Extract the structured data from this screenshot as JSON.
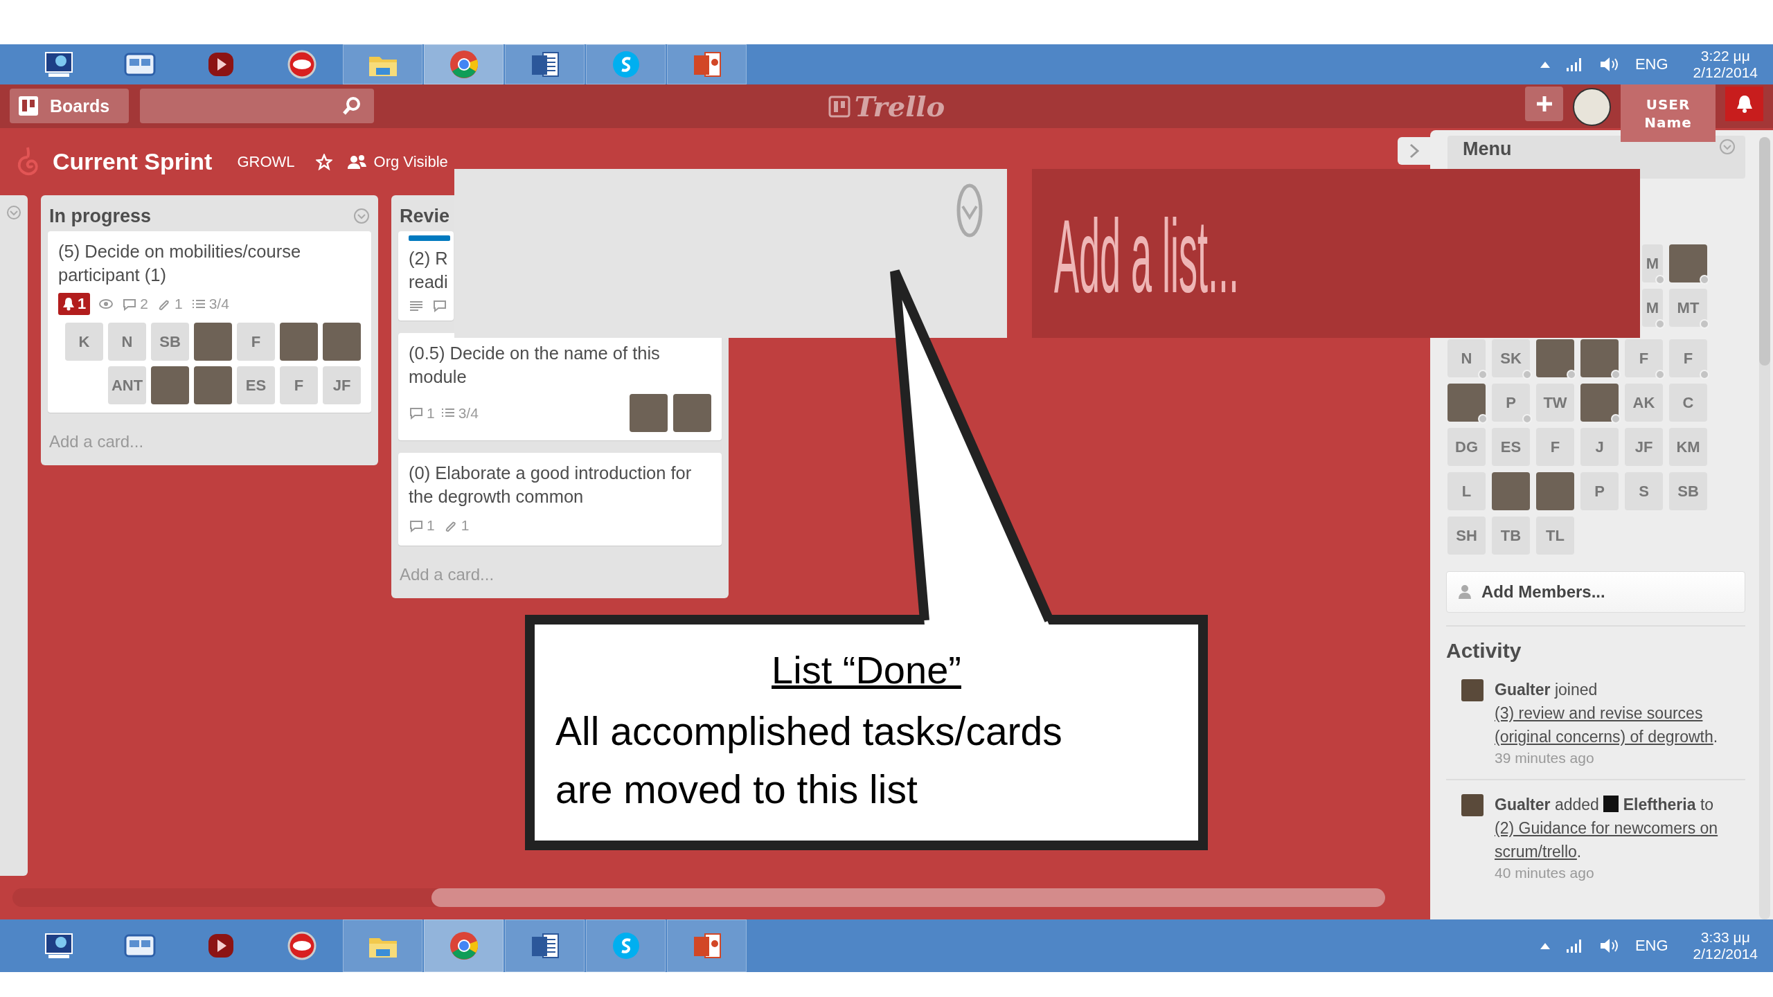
{
  "taskbars": [
    {
      "apps": [
        {
          "kind": "monitor",
          "running": false,
          "selected": false
        },
        {
          "kind": "chat",
          "running": false,
          "selected": false
        },
        {
          "kind": "media",
          "running": false,
          "selected": false
        },
        {
          "kind": "disc",
          "running": false,
          "selected": false
        },
        {
          "kind": "folder",
          "running": true,
          "selected": false
        },
        {
          "kind": "browser",
          "running": true,
          "selected": true
        },
        {
          "kind": "word",
          "running": true,
          "selected": false
        },
        {
          "kind": "skype",
          "running": true,
          "selected": false
        },
        {
          "kind": "slides",
          "running": true,
          "selected": false
        }
      ],
      "language": "ENG",
      "time": "3:22 μμ",
      "date": "2/12/2014"
    },
    {
      "apps": [
        {
          "kind": "monitor",
          "running": false,
          "selected": false
        },
        {
          "kind": "chat",
          "running": false,
          "selected": false
        },
        {
          "kind": "media",
          "running": false,
          "selected": false
        },
        {
          "kind": "disc",
          "running": false,
          "selected": false
        },
        {
          "kind": "folder",
          "running": true,
          "selected": false
        },
        {
          "kind": "browser",
          "running": true,
          "selected": true
        },
        {
          "kind": "word",
          "running": true,
          "selected": false
        },
        {
          "kind": "skype",
          "running": true,
          "selected": false
        },
        {
          "kind": "slides",
          "running": true,
          "selected": false
        }
      ],
      "language": "ENG",
      "time": "3:33 μμ",
      "date": "2/12/2014"
    }
  ],
  "header": {
    "boards_button": "Boards",
    "logo": "Trello",
    "user_name": "USER Name"
  },
  "board": {
    "title": "Current Sprint",
    "organization": "GROWL",
    "visibility": "Org Visible"
  },
  "lists": [
    {
      "title": "In progress",
      "cards": [
        {
          "title": "(5) Decide on mobilities/course participant (1)",
          "badges": [
            {
              "kind": "alert",
              "text": "1"
            },
            {
              "kind": "watch"
            },
            {
              "kind": "comments",
              "text": "2"
            },
            {
              "kind": "attachments",
              "text": "1"
            },
            {
              "kind": "checklist",
              "text": "3/4"
            }
          ],
          "members": [
            {
              "kind": "initials",
              "initials": "K"
            },
            {
              "kind": "initials",
              "initials": "N"
            },
            {
              "kind": "initials",
              "initials": "SB"
            },
            {
              "kind": "photo"
            },
            {
              "kind": "initials",
              "initials": "F"
            },
            {
              "kind": "photo"
            },
            {
              "kind": "photo"
            },
            {
              "kind": "initials",
              "initials": "ANT"
            },
            {
              "kind": "photo"
            },
            {
              "kind": "photo"
            },
            {
              "kind": "initials",
              "initials": "ES"
            },
            {
              "kind": "initials",
              "initials": "F"
            },
            {
              "kind": "initials",
              "initials": "JF"
            }
          ]
        }
      ],
      "add_card": "Add a card..."
    },
    {
      "title": "Revie",
      "cards": [
        {
          "labels": [
            {
              "color": "#0079bf"
            }
          ],
          "title_lines": [
            "(2) R",
            "readi"
          ],
          "badges": [
            {
              "kind": "description"
            },
            {
              "kind": "comments"
            }
          ]
        },
        {
          "title": "(0.5) Decide on the name of this module",
          "badges": [
            {
              "kind": "comments",
              "text": "1"
            },
            {
              "kind": "checklist",
              "text": "3/4"
            }
          ],
          "members": [
            {
              "kind": "photo"
            },
            {
              "kind": "photo"
            }
          ]
        },
        {
          "title": "(0) Elaborate a good introduction for the degrowth common",
          "badges": [
            {
              "kind": "comments",
              "text": "1"
            },
            {
              "kind": "attachments",
              "text": "1"
            }
          ]
        }
      ],
      "add_card": "Add a card..."
    }
  ],
  "sidebar": {
    "title": "Menu",
    "members_partial": [
      {
        "kind": "initials",
        "initials": "M",
        "online": true
      },
      {
        "kind": "photo",
        "online": true
      },
      {
        "kind": "initials",
        "initials": "M",
        "online": true
      },
      {
        "kind": "initials",
        "initials": "MT",
        "online": true
      }
    ],
    "members": [
      {
        "kind": "initials",
        "initials": "N",
        "online": true
      },
      {
        "kind": "initials",
        "initials": "SK",
        "online": true
      },
      {
        "kind": "photo",
        "online": true
      },
      {
        "kind": "photo",
        "online": true
      },
      {
        "kind": "initials",
        "initials": "F",
        "online": true
      },
      {
        "kind": "initials",
        "initials": "F",
        "online": true
      },
      {
        "kind": "photo",
        "online": true
      },
      {
        "kind": "initials",
        "initials": "P",
        "online": true
      },
      {
        "kind": "initials",
        "initials": "TW",
        "online": false
      },
      {
        "kind": "photo",
        "online": true
      },
      {
        "kind": "initials",
        "initials": "AK",
        "online": false
      },
      {
        "kind": "initials",
        "initials": "C",
        "online": false
      },
      {
        "kind": "initials",
        "initials": "DG",
        "online": false
      },
      {
        "kind": "initials",
        "initials": "ES",
        "online": false
      },
      {
        "kind": "initials",
        "initials": "F",
        "online": false
      },
      {
        "kind": "initials",
        "initials": "J",
        "online": false
      },
      {
        "kind": "initials",
        "initials": "JF",
        "online": false
      },
      {
        "kind": "initials",
        "initials": "KM",
        "online": false
      },
      {
        "kind": "initials",
        "initials": "L",
        "online": false
      },
      {
        "kind": "photo",
        "online": false
      },
      {
        "kind": "photo",
        "online": false
      },
      {
        "kind": "initials",
        "initials": "P",
        "online": false
      },
      {
        "kind": "initials",
        "initials": "S",
        "online": false
      },
      {
        "kind": "initials",
        "initials": "SB",
        "online": false
      },
      {
        "kind": "initials",
        "initials": "SH",
        "online": false
      },
      {
        "kind": "initials",
        "initials": "TB",
        "online": false
      },
      {
        "kind": "initials",
        "initials": "TL",
        "online": false
      }
    ],
    "add_members": "Add Members...",
    "activity_title": "Activity",
    "activity": [
      {
        "actor": "Gualter",
        "action": "joined",
        "link": "(3) review and revise sources (original concerns) of degrowth",
        "suffix": ".",
        "time": "39 minutes ago"
      },
      {
        "actor": "Gualter",
        "action": "added",
        "subject": "Eleftheria",
        "connector": "to",
        "link": "(2) Guidance for newcomers on scrum/trello",
        "suffix": ".",
        "time": "40 minutes ago"
      }
    ]
  },
  "add_list_overlay": "Add a list...",
  "callout": {
    "title": "List “Done”",
    "body": "All accomplished tasks/cards are moved to this list"
  }
}
